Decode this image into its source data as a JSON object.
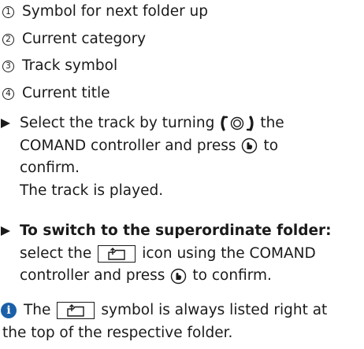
{
  "legend": [
    {
      "number": "1",
      "text": "Symbol for next folder up"
    },
    {
      "number": "2",
      "text": "Current category"
    },
    {
      "number": "3",
      "text": "Track symbol"
    },
    {
      "number": "4",
      "text": "Current title"
    }
  ],
  "step_select": {
    "part1": "Select the track by turning",
    "part2": "the",
    "line2_part1": "COMAND controller and press",
    "line2_part2": "to",
    "line3": "confirm.",
    "result": "The track is played."
  },
  "step_folder": {
    "heading": "To switch to the superordinate folder:",
    "line2_part1": "select the",
    "line2_part2": "icon using the COMAND",
    "line3_part1": "controller and press",
    "line3_part2": "to confirm."
  },
  "note": {
    "part1": "The",
    "part2": "symbol is always listed right at",
    "line2": "the top of the respective folder."
  },
  "icons": {
    "info_color": "#1a5fa8",
    "controller_icon": "turn-controller-icon",
    "press_icon": "press-controller-icon",
    "folder_icon": "folder-up-icon"
  }
}
